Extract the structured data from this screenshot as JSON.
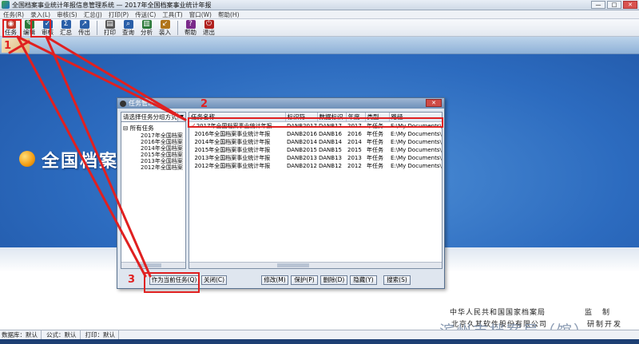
{
  "window": {
    "title": "全国档案事业统计年报信息管理系统 — 2017年全国档案事业统计年报",
    "buttons": [
      "—",
      "□",
      "✕"
    ]
  },
  "menu": [
    "任务(R)",
    "录入(L)",
    "审核(S)",
    "汇总(J)",
    "打印(P)",
    "传送(C)",
    "工具(T)",
    "窗口(W)",
    "帮助(H)"
  ],
  "toolbar": {
    "group1": [
      {
        "label": "任务",
        "icon": "task-icon",
        "color": "#c0392b"
      },
      {
        "label": "编辑",
        "icon": "edit-icon",
        "color": "#2c7a3a"
      },
      {
        "label": "审核",
        "icon": "review-icon",
        "color": "#2a5fa8"
      },
      {
        "label": "汇总",
        "icon": "summary-icon",
        "color": "#2a5fa8"
      },
      {
        "label": "传出",
        "icon": "export-icon",
        "color": "#2a5fa8"
      }
    ],
    "group2": [
      {
        "label": "打印",
        "icon": "print-icon",
        "color": "#555555"
      },
      {
        "label": "查询",
        "icon": "query-icon",
        "color": "#2a5fa8"
      },
      {
        "label": "分析",
        "icon": "analysis-icon",
        "color": "#2c7a3a"
      },
      {
        "label": "装入",
        "icon": "import-icon",
        "color": "#b0741a"
      }
    ],
    "group3": [
      {
        "label": "帮助",
        "icon": "help-icon",
        "color": "#7a2a8a"
      },
      {
        "label": "退出",
        "icon": "exit-icon",
        "color": "#b0201e"
      }
    ]
  },
  "banner": {
    "title": "全国档案",
    "sponsor_org1": "中华人民共和国国家档案局",
    "sponsor_role1": "监　制",
    "sponsor_org2": "北京久其软件股份有限公司",
    "sponsor_role2": "研制开发",
    "watermark": "滨州市档案局（馆）"
  },
  "status": [
    "数据库：默认",
    "公式：默认",
    "打印：默认"
  ],
  "dialog": {
    "title": "任务管理",
    "group_combo": "请选择任务分组方式",
    "tree_root": "所有任务",
    "tree_nodes": [
      "2017年全国档案",
      "2016年全国档案",
      "2014年全国档案",
      "2015年全国档案",
      "2013年全国档案",
      "2012年全国档案"
    ],
    "columns": [
      "任务名称",
      "标识符",
      "数据标识",
      "年度",
      "类型",
      "路径"
    ],
    "rows": [
      [
        "2017年全国档案事业统计年报",
        "DANB2017",
        "DANB17",
        "2017",
        "年任务",
        "E:\\My Documents\\..."
      ],
      [
        "2016年全国档案事业统计年报",
        "DANB2016",
        "DANB16",
        "2016",
        "年任务",
        "E:\\My Documents\\..."
      ],
      [
        "2014年全国档案事业统计年报",
        "DANB2014",
        "DANB14",
        "2014",
        "年任务",
        "E:\\My Documents\\..."
      ],
      [
        "2015年全国档案事业统计年报",
        "DANB2015",
        "DANB15",
        "2015",
        "年任务",
        "E:\\My Documents\\..."
      ],
      [
        "2013年全国档案事业统计年报",
        "DANB2013",
        "DANB13",
        "2013",
        "年任务",
        "E:\\My Documents\\..."
      ],
      [
        "2012年全国档案事业统计年报",
        "DANB2012",
        "DANB12",
        "2012",
        "年任务",
        "E:\\My Documents\\..."
      ]
    ],
    "buttons": {
      "set_current": "作为当前任务(Q)",
      "close": "关闭(C)",
      "modify": "修改(M)",
      "protect": "保护(P)",
      "delete": "删除(D)",
      "hide": "隐藏(Y)",
      "search": "搜索(S)"
    }
  },
  "annotations": {
    "step1": "1",
    "step2": "2",
    "step3": "3",
    "color": "#e02020"
  }
}
